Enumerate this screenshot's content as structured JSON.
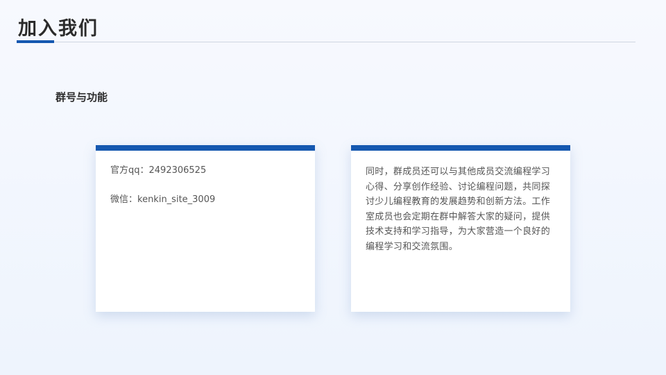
{
  "page": {
    "title": "加入我们",
    "subtitle": "群号与功能"
  },
  "cards": {
    "contact": {
      "qq": "官方qq：2492306525",
      "wechat": "微信：kenkin_site_3009"
    },
    "description": "同时，群成员还可以与其他成员交流编程学习心得、分享创作经验、讨论编程问题，共同探讨少儿编程教育的发展趋势和创新方法。工作室成员也会定期在群中解答大家的疑问，提供技术支持和学习指导，为大家营造一个良好的编程学习和交流氛围。"
  },
  "colors": {
    "accent": "#1558b0",
    "background": "#f3f7fd",
    "card": "#ffffff",
    "title_text": "#2b2b2b",
    "body_text": "#555555"
  }
}
